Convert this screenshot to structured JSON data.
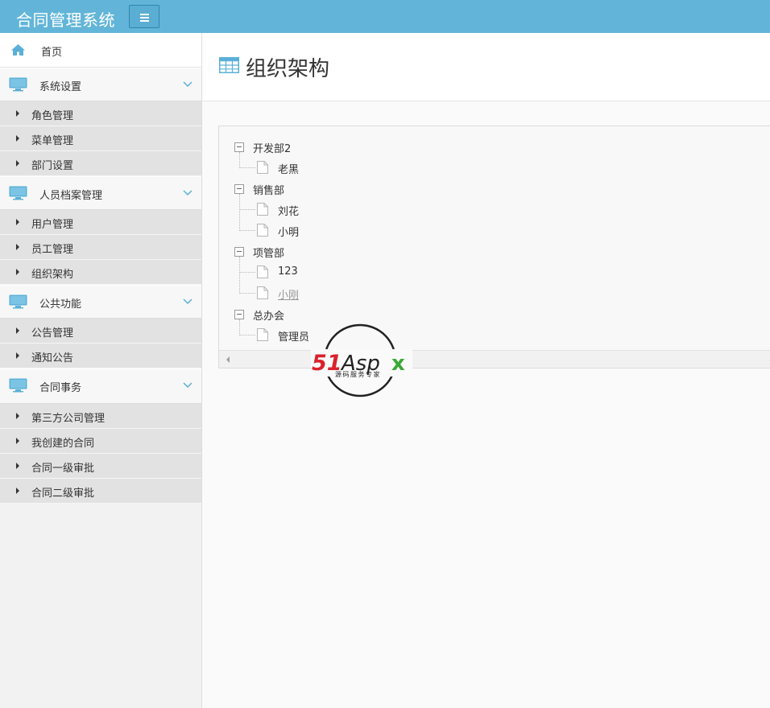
{
  "app": {
    "title": "合同管理系统"
  },
  "sidebar": {
    "home_label": "首页",
    "groups": [
      {
        "label": "系统设置",
        "items": [
          "角色管理",
          "菜单管理",
          "部门设置"
        ]
      },
      {
        "label": "人员档案管理",
        "items": [
          "用户管理",
          "员工管理",
          "组织架构"
        ]
      },
      {
        "label": "公共功能",
        "items": [
          "公告管理",
          "通知公告"
        ]
      },
      {
        "label": "合同事务",
        "items": [
          "第三方公司管理",
          "我创建的合同",
          "合同一级审批",
          "合同二级审批"
        ]
      }
    ]
  },
  "main": {
    "title": "组织架构",
    "tree": [
      {
        "label": "开发部2",
        "children": [
          "老黑"
        ]
      },
      {
        "label": "销售部",
        "children": [
          "刘花",
          "小明"
        ]
      },
      {
        "label": "项管部",
        "children": [
          "123",
          "小刚"
        ]
      },
      {
        "label": "总办会",
        "children": [
          "管理员"
        ]
      }
    ]
  },
  "watermark": {
    "brand": "51Aspx",
    "brand_red": "51",
    "brand_dark": "Asp",
    "brand_green": "x",
    "tagline": "源码服务专家"
  },
  "colors": {
    "topbar": "#62b5d8",
    "accent_blue": "#5ab0d8",
    "sidebar_bg": "#f2f2f2",
    "submenu_bg": "#e2e2e2"
  },
  "icons": {
    "menu_toggle": "hamburger-icon",
    "home": "home-icon",
    "group": "monitor-icon",
    "group_toggle": "chevron-down-icon",
    "subitem": "caret-right-icon",
    "title": "table-icon",
    "tree_toggle": "minus-square-icon",
    "tree_leaf": "file-icon"
  }
}
